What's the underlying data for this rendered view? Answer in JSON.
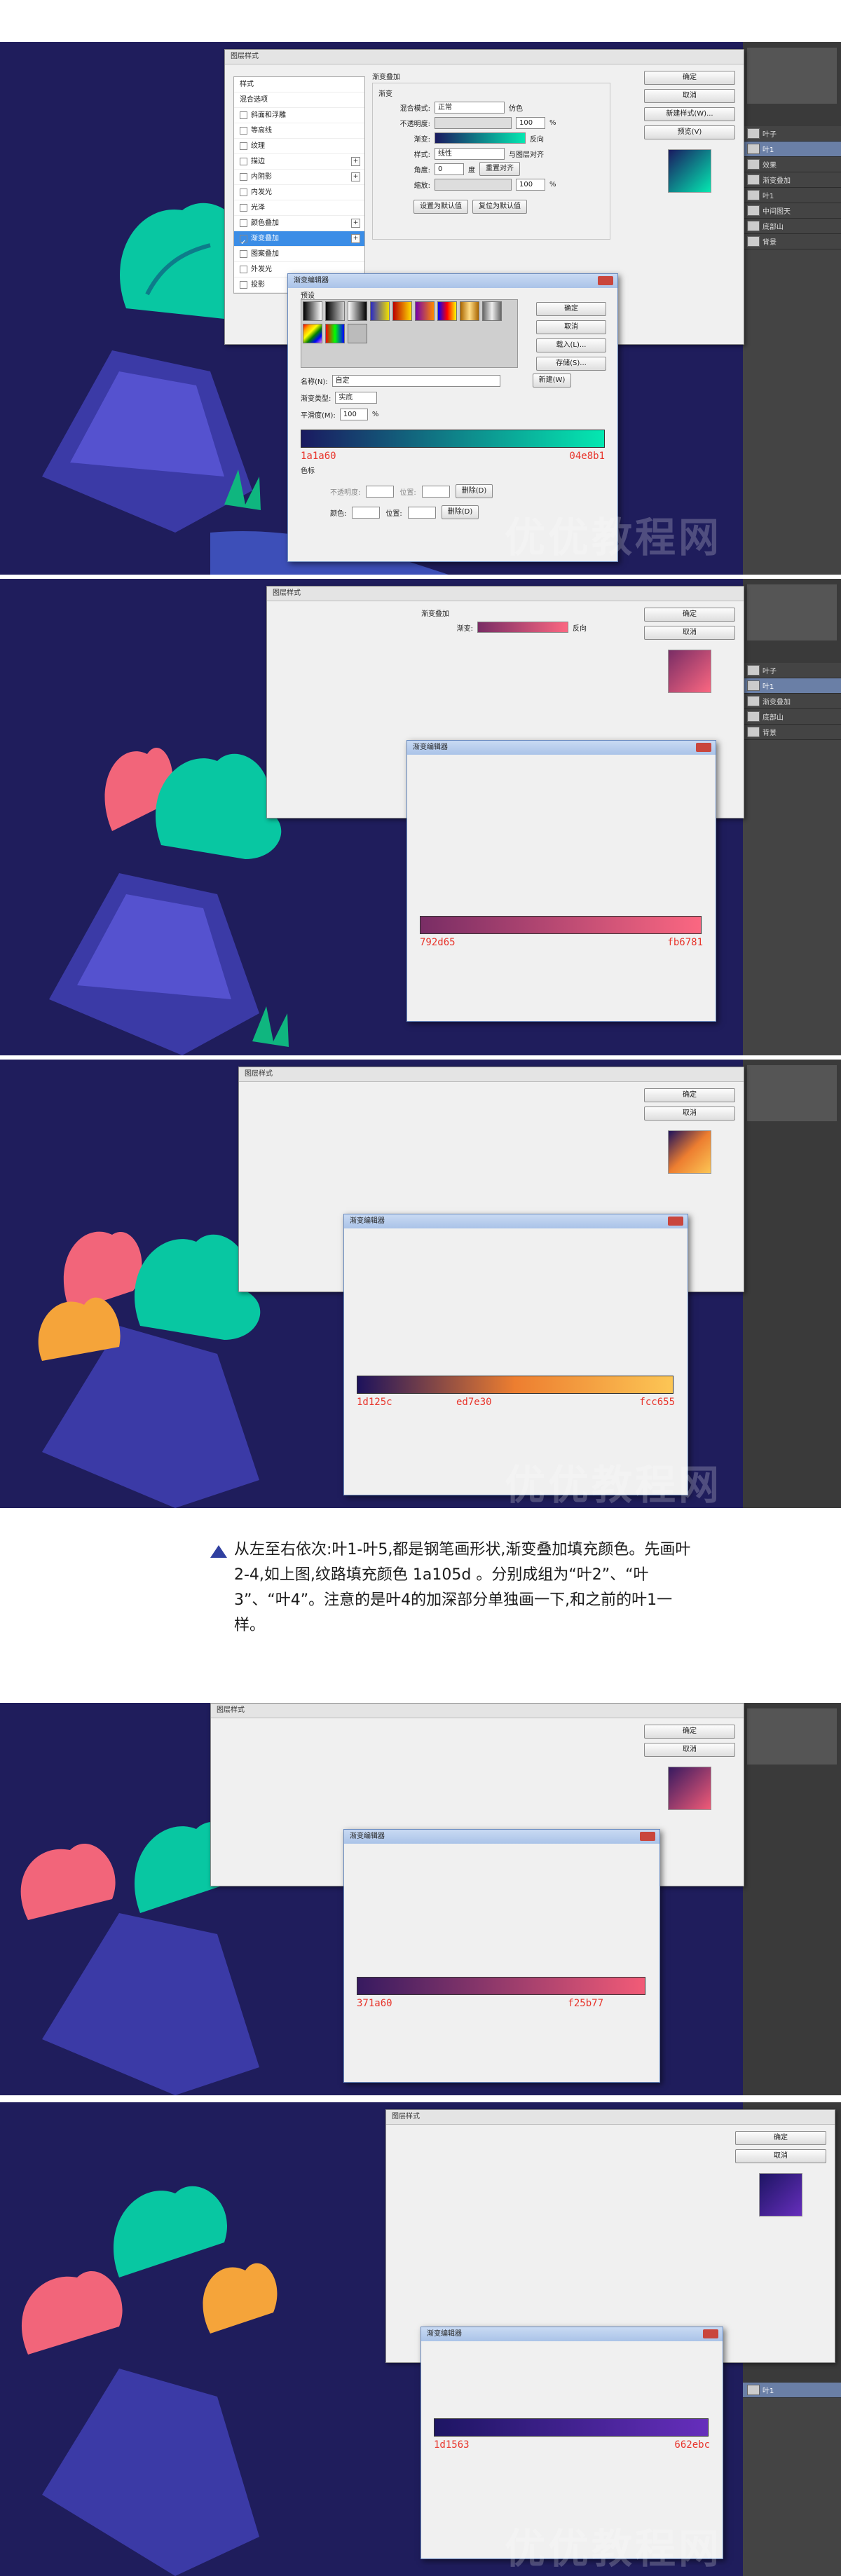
{
  "panels": [
    {
      "id": "p1",
      "layer_style_title": "图层样式",
      "gradient_overlay_title": "渐变叠加",
      "gradient_editor_title": "渐变编辑器",
      "stop_left": "1a1a60",
      "stop_right": "04e8b1",
      "stop_mid": "",
      "gradient_colors": [
        "#1a1a60",
        "#04e8b1"
      ]
    },
    {
      "id": "p2",
      "layer_style_title": "图层样式",
      "gradient_overlay_title": "渐变叠加",
      "gradient_editor_title": "渐变编辑器",
      "stop_left": "792d65",
      "stop_right": "fb6781",
      "stop_mid": "",
      "gradient_colors": [
        "#792d65",
        "#fb6781"
      ]
    },
    {
      "id": "p3",
      "layer_style_title": "图层样式",
      "gradient_overlay_title": "渐变叠加",
      "gradient_editor_title": "渐变编辑器",
      "stop_left": "1d125c",
      "stop_mid": "ed7e30",
      "stop_right": "fcc655",
      "gradient_colors": [
        "#1d125c",
        "#ed7e30",
        "#fcc655"
      ]
    },
    {
      "id": "p4",
      "layer_style_title": "图层样式",
      "gradient_overlay_title": "渐变叠加",
      "gradient_editor_title": "渐变编辑器",
      "stop_left": "371a60",
      "stop_right": "f25b77",
      "stop_mid": "",
      "gradient_colors": [
        "#371a60",
        "#f25b77"
      ]
    },
    {
      "id": "p5",
      "layer_style_title": "图层样式",
      "gradient_overlay_title": "渐变叠加",
      "gradient_editor_title": "渐变编辑器",
      "stop_left": "1d1563",
      "stop_right": "662ebc",
      "stop_mid": "",
      "gradient_colors": [
        "#1d1563",
        "#662ebc"
      ]
    }
  ],
  "layer_style": {
    "title": "图层样式",
    "styles_header": "样式",
    "items": [
      {
        "label": "混合选项",
        "checked": false
      },
      {
        "label": "斜面和浮雕",
        "checked": false
      },
      {
        "label": "等高线",
        "checked": false
      },
      {
        "label": "纹理",
        "checked": false
      },
      {
        "label": "描边",
        "checked": false,
        "plus": true
      },
      {
        "label": "内阴影",
        "checked": false,
        "plus": true
      },
      {
        "label": "内发光",
        "checked": false
      },
      {
        "label": "光泽",
        "checked": false
      },
      {
        "label": "颜色叠加",
        "checked": false,
        "plus": true
      },
      {
        "label": "渐变叠加",
        "checked": true,
        "plus": true,
        "selected": true
      },
      {
        "label": "图案叠加",
        "checked": false
      },
      {
        "label": "外发光",
        "checked": false
      },
      {
        "label": "投影",
        "checked": false,
        "plus": true
      }
    ],
    "group_title": "渐变叠加",
    "group_sub": "渐变",
    "blend_mode_label": "混合模式:",
    "blend_mode_value": "正常",
    "dither_label": "仿色",
    "opacity_label": "不透明度:",
    "opacity_value": "100",
    "gradient_label": "渐变:",
    "reverse_label": "反向",
    "style_label": "样式:",
    "style_value": "线性",
    "align_label": "与图层对齐",
    "angle_label": "角度:",
    "angle_value": "0",
    "angle_unit": "度",
    "reset_align_label": "重置对齐",
    "scale_label": "缩放:",
    "scale_value": "100",
    "percent": "%",
    "set_default": "设置为默认值",
    "reset_default": "复位为默认值",
    "buttons": {
      "ok": "确定",
      "cancel": "取消",
      "new_style": "新建样式(W)...",
      "preview": "预览(V)"
    }
  },
  "gradient_editor": {
    "title": "渐变编辑器",
    "presets_label": "预设",
    "name_label": "名称(N):",
    "name_value": "自定",
    "new_button": "新建(W)",
    "type_label": "渐变类型:",
    "type_value": "实底",
    "smooth_label": "平滑度(M):",
    "smooth_value": "100",
    "stops_label": "色标",
    "opacity_label": "不透明度:",
    "location_label": "位置:",
    "delete_label": "删除(D)",
    "color_label": "颜色:",
    "buttons": {
      "ok": "确定",
      "cancel": "取消",
      "load": "载入(L)...",
      "save": "存储(S)..."
    }
  },
  "layers": [
    {
      "label": "叶子",
      "selected": false
    },
    {
      "label": "叶1",
      "selected": true
    },
    {
      "label": "效果",
      "selected": false
    },
    {
      "label": "渐变叠加",
      "selected": false
    },
    {
      "label": "叶1",
      "selected": false
    },
    {
      "label": "叶1",
      "selected": false
    },
    {
      "label": "中间图天",
      "selected": false
    },
    {
      "label": "底部山",
      "selected": false
    },
    {
      "label": "背景",
      "selected": false
    }
  ],
  "note": {
    "text": "从左至右依次:叶1-叶5,都是钢笔画形状,渐变叠加填充颜色。先画叶2-4,如上图,纹路填充颜色 1a105d 。分别成组为“叶2”、“叶3”、“叶4”。注意的是叶4的加深部分单独画一下,和之前的叶1一样。"
  },
  "watermark": "优优教程网",
  "colors": {
    "canvas_bg": "#1f1d5c",
    "accent_select": "#3b8de6",
    "ps_dark": "#3a3a3a"
  }
}
